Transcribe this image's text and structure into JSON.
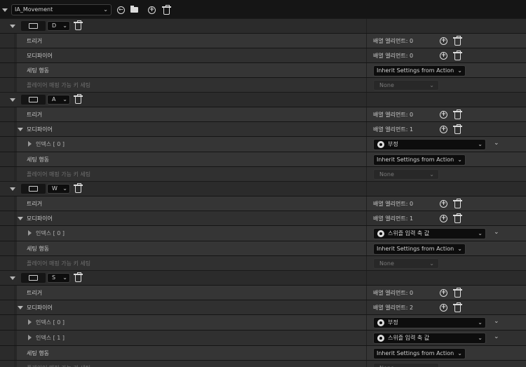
{
  "toolbar": {
    "asset_value": "IA_Movement",
    "icons": [
      "back-arrow-icon",
      "browse-folder-icon",
      "add-icon",
      "trash-icon"
    ]
  },
  "common": {
    "triggers_label": "트리거",
    "modifiers_label": "모디파이어",
    "setting_behavior_label": "세팅 행동",
    "player_mappable_label": "플레이어 매핑 가능 키 세팅",
    "inherit_value": "Inherit Settings from Action",
    "none_value": "None"
  },
  "mappings": [
    {
      "key": "D",
      "triggers_count": "배열 엘리먼트: 0",
      "modifiers_count": "배열 엘리먼트: 0",
      "modifiers": []
    },
    {
      "key": "A",
      "triggers_count": "배열 엘리먼트: 0",
      "modifiers_count": "배열 엘리먼트: 1",
      "modifiers": [
        {
          "index_label": "인덱스 [ 0 ]",
          "value": "부정"
        }
      ]
    },
    {
      "key": "W",
      "triggers_count": "배열 엘리먼트: 0",
      "modifiers_count": "배열 엘리먼트: 1",
      "modifiers": [
        {
          "index_label": "인덱스 [ 0 ]",
          "value": "스위즐 입력 축 값"
        }
      ]
    },
    {
      "key": "S",
      "triggers_count": "배열 엘리먼트: 0",
      "modifiers_count": "배열 엘리먼트: 2",
      "modifiers": [
        {
          "index_label": "인덱스 [ 0 ]",
          "value": "부정"
        },
        {
          "index_label": "인덱스 [ 1 ]",
          "value": "스위즐 입력 축 값"
        }
      ]
    }
  ]
}
